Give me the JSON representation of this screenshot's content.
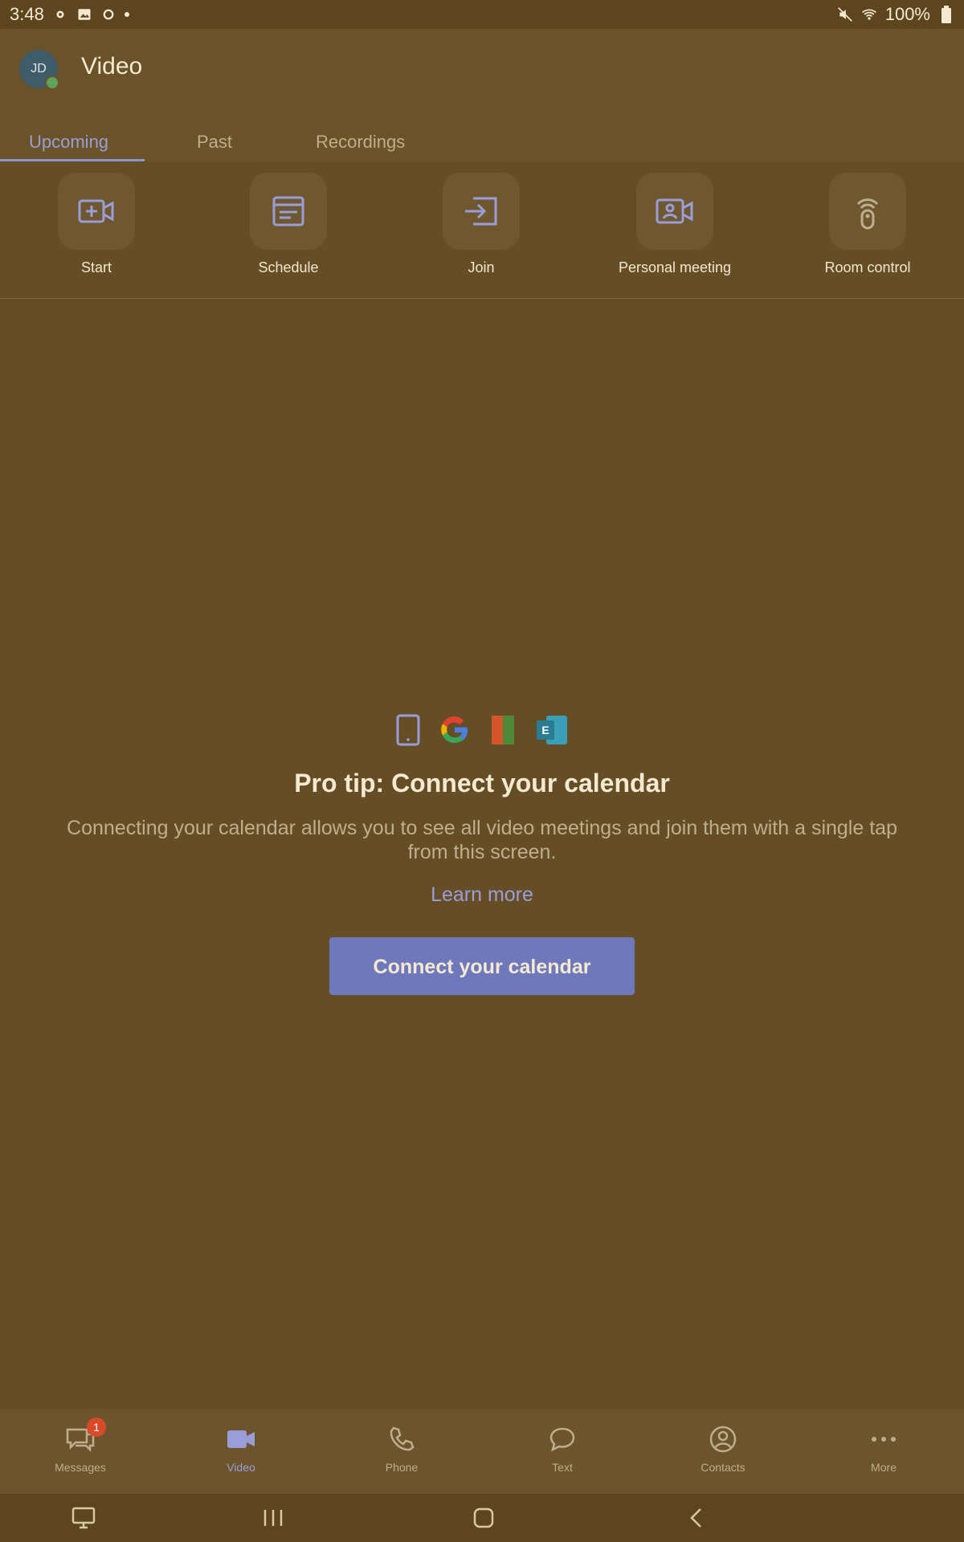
{
  "status_bar": {
    "time": "3:48",
    "battery": "100%",
    "left_icons": [
      "settings-icon",
      "photo-icon",
      "settings-icon",
      "dot-icon"
    ],
    "right_icons": [
      "mute-icon",
      "wifi-icon",
      "battery-icon"
    ]
  },
  "header": {
    "avatar_initials": "JD",
    "title": "Video"
  },
  "tabs": [
    {
      "label": "Upcoming",
      "active": true
    },
    {
      "label": "Past",
      "active": false
    },
    {
      "label": "Recordings",
      "active": false
    }
  ],
  "actions": [
    {
      "label": "Start",
      "icon": "video-plus-icon"
    },
    {
      "label": "Schedule",
      "icon": "calendar-icon"
    },
    {
      "label": "Join",
      "icon": "join-icon"
    },
    {
      "label": "Personal meeting",
      "icon": "personal-meeting-icon"
    },
    {
      "label": "Room control",
      "icon": "room-control-icon"
    }
  ],
  "promo": {
    "calendar_icons": [
      "phone-calendar-icon",
      "google-icon",
      "office-icon",
      "exchange-icon"
    ],
    "title": "Pro tip: Connect your calendar",
    "body": "Connecting your calendar allows you to see all video meetings and join them with a single tap from this screen.",
    "learn_more": "Learn more",
    "cta": "Connect your calendar"
  },
  "bottom_nav": [
    {
      "label": "Messages",
      "icon": "chat-icon",
      "badge": "1",
      "active": false
    },
    {
      "label": "Video",
      "icon": "video-icon",
      "active": true
    },
    {
      "label": "Phone",
      "icon": "phone-icon",
      "active": false
    },
    {
      "label": "Text",
      "icon": "text-icon",
      "active": false
    },
    {
      "label": "Contacts",
      "icon": "contacts-icon",
      "active": false
    },
    {
      "label": "More",
      "icon": "more-icon",
      "active": false
    }
  ],
  "colors": {
    "background": "#654d26",
    "accent": "#6e79bb",
    "active_tab": "#9a9ed8"
  }
}
